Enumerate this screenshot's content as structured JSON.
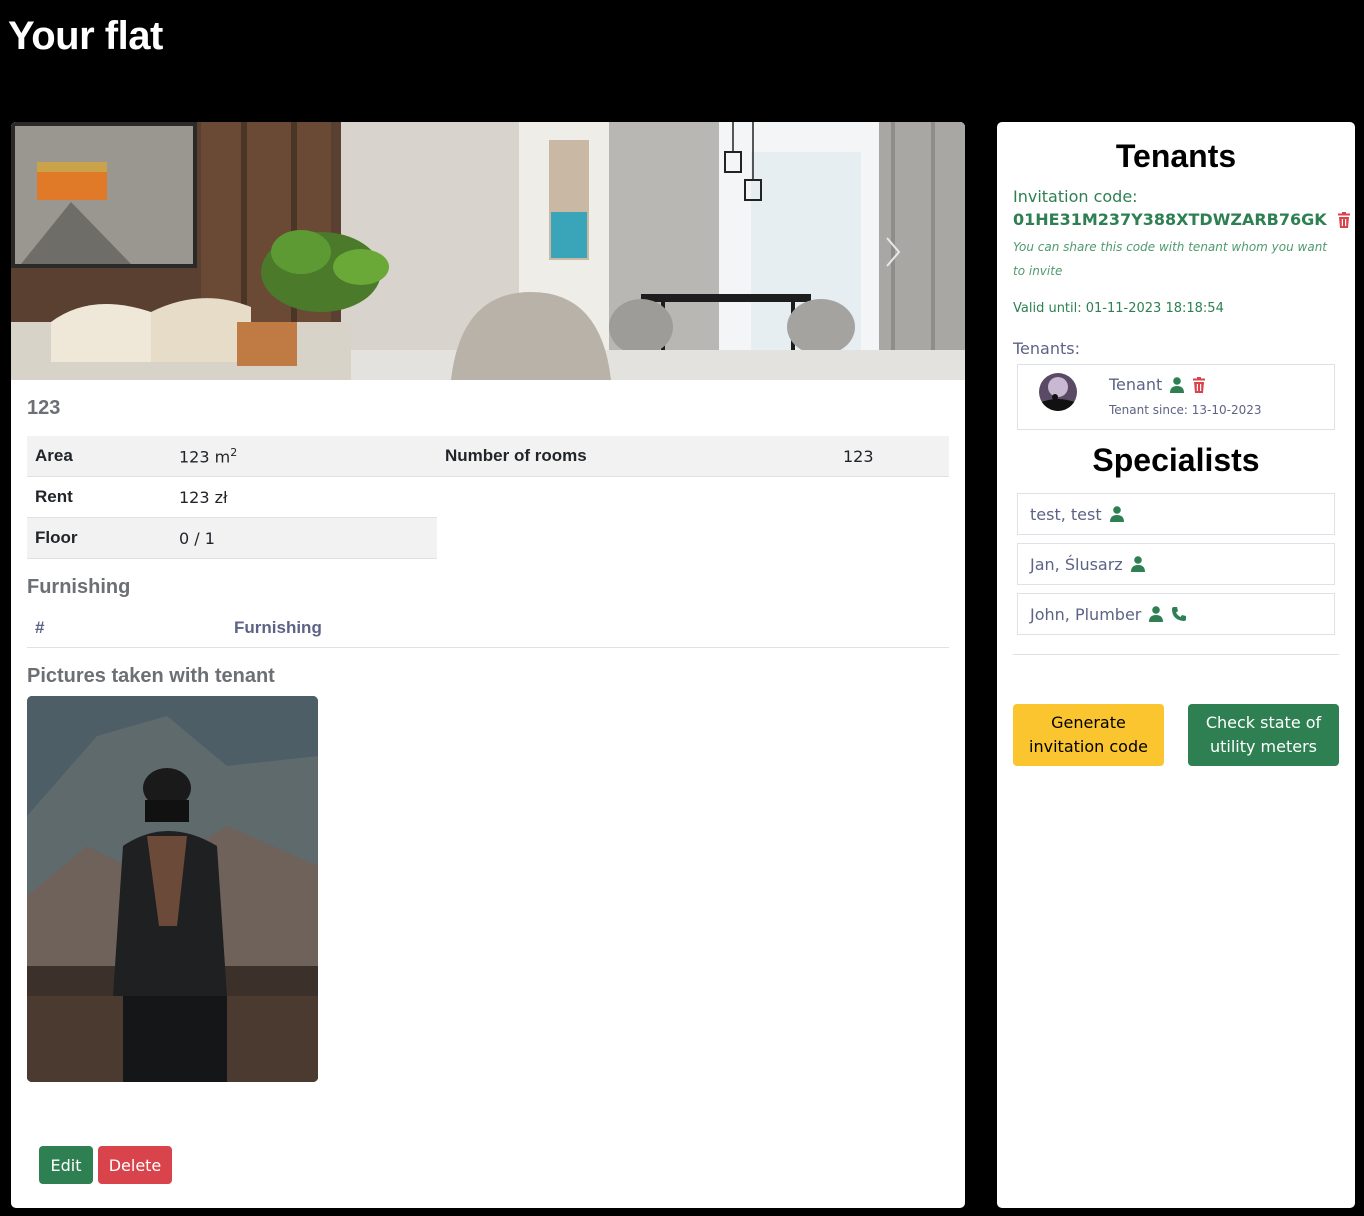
{
  "page": {
    "title": "Your flat"
  },
  "flat": {
    "name": "123",
    "details": {
      "area_label": "Area",
      "area_value": "123 m",
      "area_unit_sup": "2",
      "rooms_label": "Number of rooms",
      "rooms_value": "123",
      "rent_label": "Rent",
      "rent_value": "123 zł",
      "floor_label": "Floor",
      "floor_value": "0 / 1"
    },
    "furnishing": {
      "heading": "Furnishing",
      "col_number": "#",
      "col_name": "Furnishing"
    },
    "pictures_heading": "Pictures taken with tenant",
    "actions": {
      "edit_label": "Edit",
      "delete_label": "Delete"
    }
  },
  "tenants_panel": {
    "heading": "Tenants",
    "invitation_label": "Invitation code:",
    "invitation_code": "01HE31M237Y388XTDWZARB76GK",
    "invitation_hint": "You can share this code with tenant whom you want to invite",
    "valid_until": "Valid until: 01-11-2023 18:18:54",
    "tenants_label": "Tenants:",
    "tenants": [
      {
        "name": "Tenant",
        "since": "Tenant since: 13-10-2023"
      }
    ]
  },
  "specialists_panel": {
    "heading": "Specialists",
    "items": [
      {
        "name": "test, test"
      },
      {
        "name": "Jan, Ślusarz"
      },
      {
        "name": "John, Plumber"
      }
    ]
  },
  "side_actions": {
    "generate_label": "Generate invitation code",
    "utility_label": "Check state of utility meters"
  },
  "colors": {
    "primary_green": "#2e8053",
    "danger_red": "#d9434b",
    "warning_yellow": "#fac52e",
    "muted_text": "#5d6385"
  }
}
